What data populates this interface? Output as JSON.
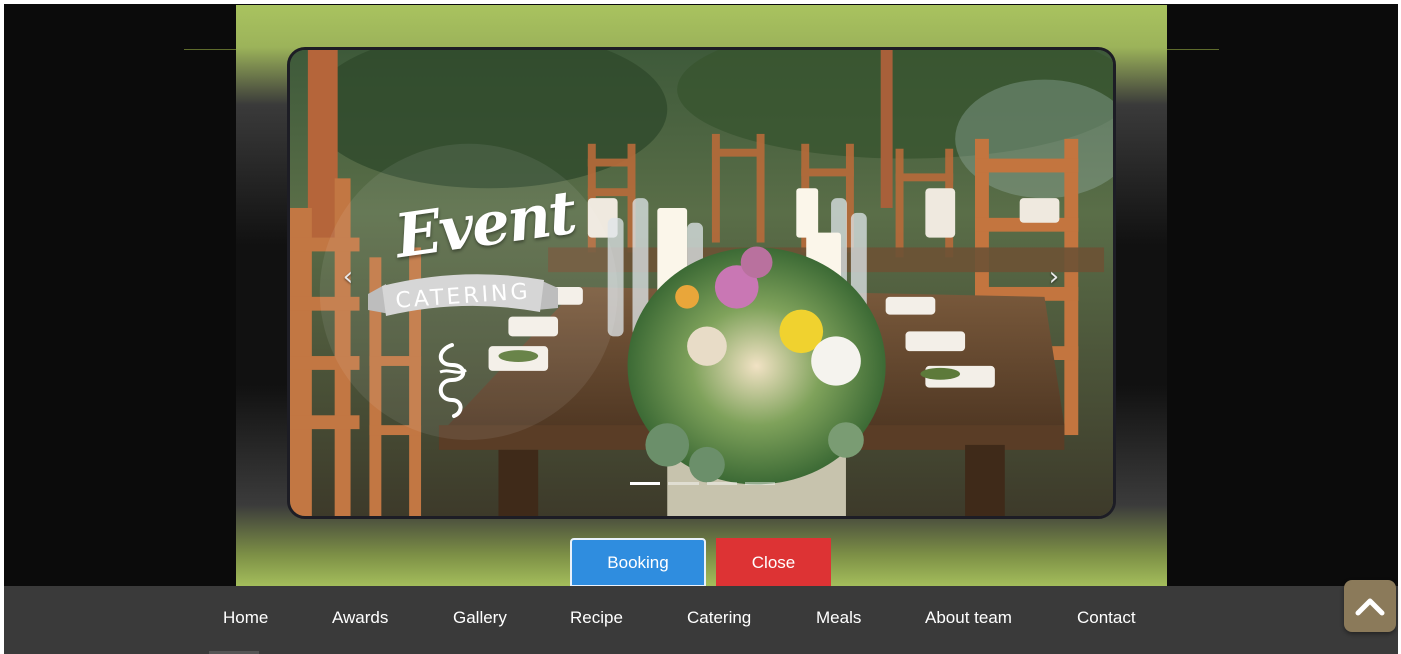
{
  "carousel": {
    "logo_word": "Event",
    "logo_banner": "CATERING",
    "prev_icon": "chevron-left",
    "next_icon": "chevron-right",
    "prev_glyph": "‹",
    "next_glyph": "›",
    "indicator_count": 4,
    "active_indicator": 1
  },
  "modal": {
    "booking_label": "Booking",
    "close_label": "Close"
  },
  "nav": {
    "items": [
      {
        "label": "Home"
      },
      {
        "label": "Awards"
      },
      {
        "label": "Gallery"
      },
      {
        "label": "Recipe"
      },
      {
        "label": "Catering"
      },
      {
        "label": "Meals"
      },
      {
        "label": "About team"
      },
      {
        "label": "Contact"
      }
    ]
  },
  "scroll_top": {
    "icon": "chevron-up"
  },
  "colors": {
    "modal_green": "#a9c35f",
    "booking_blue": "#2f8ddf",
    "close_red": "#dd3334",
    "navbar": "#3a3a3a",
    "scroll_top": "#8b7a5a"
  }
}
